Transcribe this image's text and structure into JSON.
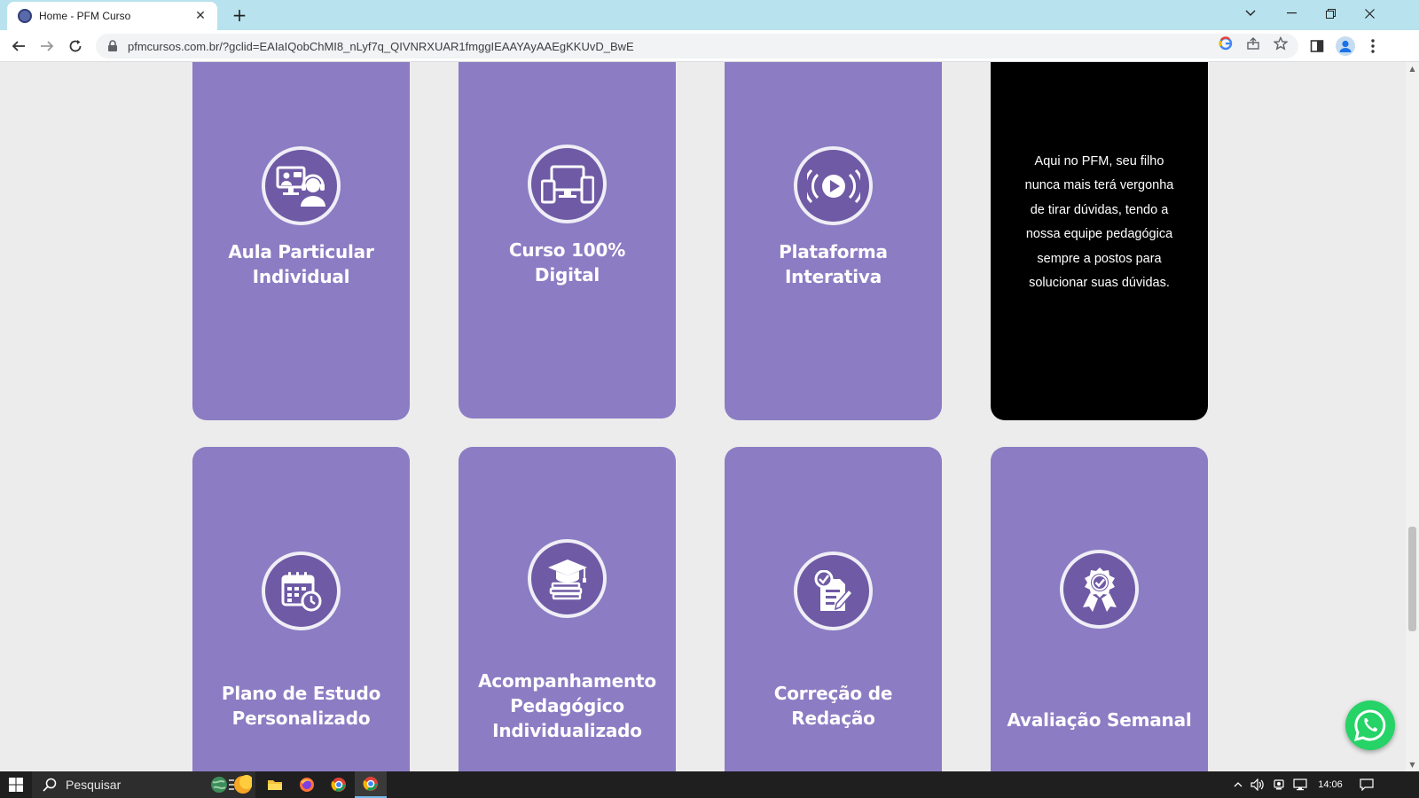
{
  "browser": {
    "tab_title": "Home - PFM Curso",
    "tab_close": "✕",
    "new_tab": "+",
    "url": "pfmcursos.com.br/?gclid=EAIaIQobChMI8_nLyf7q_QIVNRXUAR1fmggIEAAYAyAAEgKKUvD_BwE"
  },
  "cards_row1": [
    {
      "title_l1": "Aula Particular",
      "title_l2": "Individual",
      "icon": "online-tutor-icon"
    },
    {
      "title_l1": "Curso 100%",
      "title_l2": "Digital",
      "icon": "devices-icon"
    },
    {
      "title_l1": "Plataforma",
      "title_l2": "Interativa",
      "icon": "play-broadcast-icon"
    }
  ],
  "info_card": {
    "lines": [
      "Aqui no PFM, seu filho",
      "nunca mais terá vergonha",
      "de tirar dúvidas, tendo a",
      "nossa equipe pedagógica",
      "sempre a postos para",
      "solucionar suas dúvidas."
    ]
  },
  "cards_row2": [
    {
      "title_l1": "Plano de Estudo",
      "title_l2": "Personalizado",
      "icon": "calendar-clock-icon"
    },
    {
      "title_l1": "Acompanhamento",
      "title_l2": "Pedagógico",
      "title_l3": "Individualizado",
      "icon": "graduation-books-icon"
    },
    {
      "title_l1": "Correção de",
      "title_l2": "Redação",
      "icon": "essay-check-icon"
    },
    {
      "title_l1": "Avaliação Semanal",
      "icon": "award-badge-icon"
    }
  ],
  "taskbar": {
    "search_placeholder": "Pesquisar",
    "time": "14:06"
  },
  "colors": {
    "card_purple": "#8c7cc3",
    "icon_purple": "#6f5aa5",
    "info_card": "#000000",
    "page_bg": "#ececec",
    "whatsapp": "#25d366"
  }
}
